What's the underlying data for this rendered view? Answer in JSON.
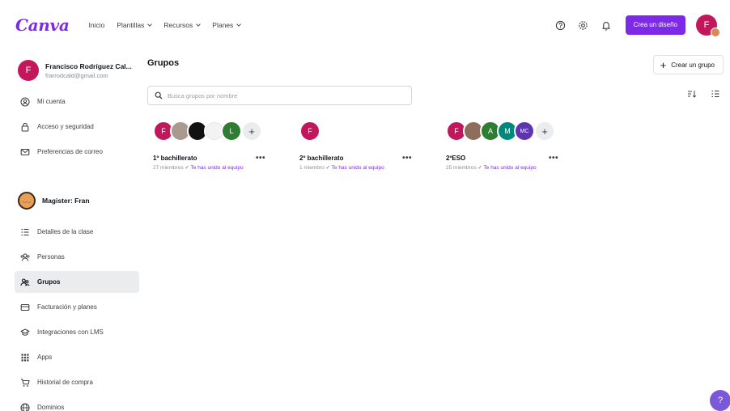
{
  "app": {
    "logo": "Canva"
  },
  "nav": [
    {
      "label": "Inicio",
      "dropdown": false
    },
    {
      "label": "Plantillas",
      "dropdown": true
    },
    {
      "label": "Recursos",
      "dropdown": true
    },
    {
      "label": "Planes",
      "dropdown": true
    }
  ],
  "header": {
    "create_label": "Crea un diseño",
    "avatar_initial": "F"
  },
  "profile": {
    "initial": "F",
    "name": "Francisco Rodríguez Cal...",
    "email": "frarrodcald@gmail.com"
  },
  "sidebar": {
    "account_items": [
      {
        "label": "Mi cuenta",
        "icon": "user-circle-icon"
      },
      {
        "label": "Acceso y seguridad",
        "icon": "lock-icon"
      },
      {
        "label": "Preferencias de correo",
        "icon": "mail-icon"
      }
    ],
    "team": {
      "name": "Magister: Fran"
    },
    "team_items": [
      {
        "label": "Detalles de la clase",
        "icon": "list-icon",
        "active": false
      },
      {
        "label": "Personas",
        "icon": "people-icon",
        "active": false
      },
      {
        "label": "Grupos",
        "icon": "groups-icon",
        "active": true
      },
      {
        "label": "Facturación y planes",
        "icon": "card-icon",
        "active": false
      },
      {
        "label": "Integraciones con LMS",
        "icon": "graduation-cap-icon",
        "active": false
      },
      {
        "label": "Apps",
        "icon": "apps-grid-icon",
        "active": false
      },
      {
        "label": "Historial de compra",
        "icon": "cart-icon",
        "active": false
      },
      {
        "label": "Dominios",
        "icon": "globe-icon",
        "active": false
      }
    ]
  },
  "main": {
    "title": "Grupos",
    "create_group_label": "Crear un grupo",
    "search_placeholder": "Busca grupos por nombre",
    "groups": [
      {
        "name": "1º bachillerato",
        "count": "27 miembros",
        "joined": "Te has unido al equipo",
        "avatars": [
          {
            "text": "F",
            "color": "#c2185b"
          },
          {
            "text": "",
            "color": "#a89a8f"
          },
          {
            "text": "",
            "color": "#111111"
          },
          {
            "text": "",
            "color": "#f3f3f3"
          },
          {
            "text": "L",
            "color": "#2e7d32"
          }
        ],
        "more": true
      },
      {
        "name": "2º bachillerato",
        "count": "1 miembro",
        "joined": "Te has unido al equipo",
        "avatars": [
          {
            "text": "F",
            "color": "#c2185b"
          }
        ],
        "more": false
      },
      {
        "name": "2ºESO",
        "count": "25 miembros",
        "joined": "Te has unido al equipo",
        "avatars": [
          {
            "text": "F",
            "color": "#c2185b"
          },
          {
            "text": "",
            "color": "#8d6e5a"
          },
          {
            "text": "A",
            "color": "#2e7d32"
          },
          {
            "text": "M",
            "color": "#00897b"
          },
          {
            "text": "MC",
            "color": "#5e35b1"
          }
        ],
        "more": true
      }
    ]
  },
  "help": {
    "label": "?"
  }
}
